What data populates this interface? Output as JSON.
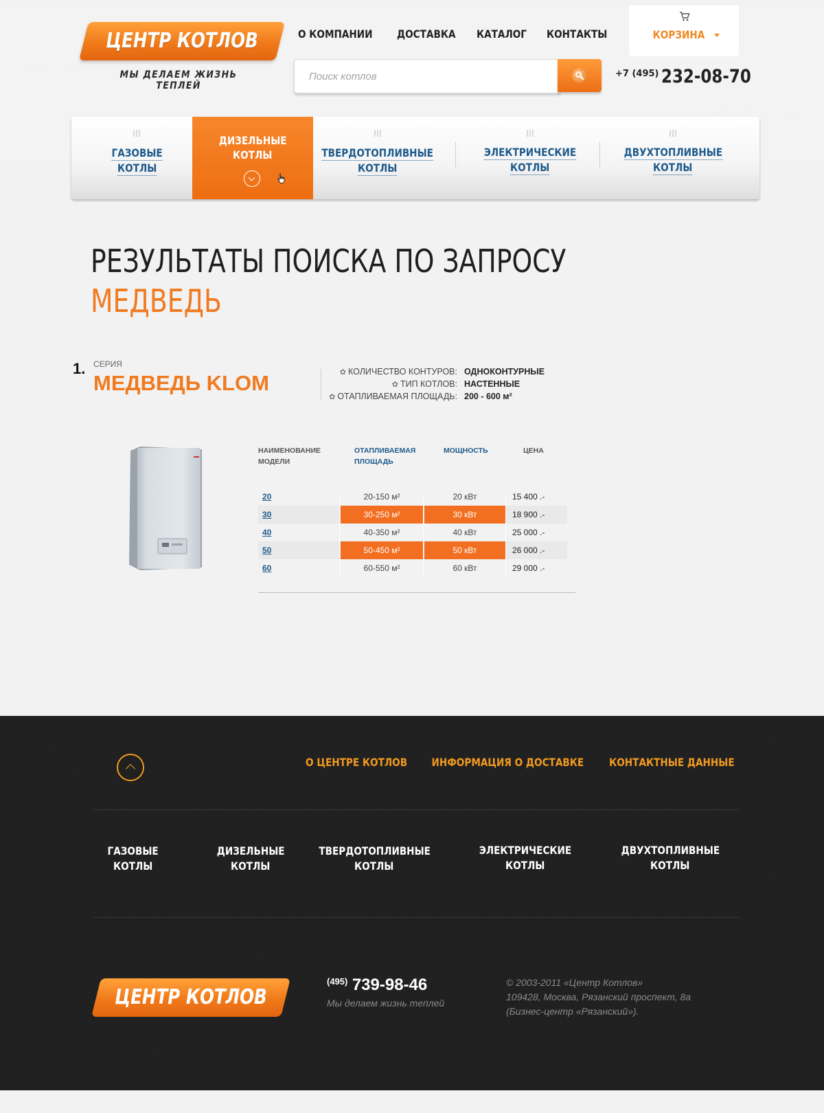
{
  "header": {
    "logo_text": "ЦЕНТР КОТЛОВ",
    "tagline": "МЫ ДЕЛАЕМ ЖИЗНЬ ТЕПЛЕЙ",
    "nav": [
      "О КОМПАНИИ",
      "ДОСТАВКА",
      "КАТАЛОГ",
      "КОНТАКТЫ"
    ],
    "cart_label": "КОРЗИНА",
    "search": {
      "placeholder": "Поиск котлов",
      "value": ""
    },
    "phone_code": "+7 (495)",
    "phone_number": "232-08-70"
  },
  "categories": [
    {
      "line1": "ГАЗОВЫЕ",
      "line2": "КОТЛЫ",
      "active": false
    },
    {
      "line1": "ДИЗЕЛЬНЫЕ",
      "line2": "КОТЛЫ",
      "active": true
    },
    {
      "line1": "ТВЕРДОТОПЛИВНЫЕ",
      "line2": "КОТЛЫ",
      "active": false
    },
    {
      "line1": "ЭЛЕКТРИЧЕСКИЕ",
      "line2": "КОТЛЫ",
      "active": false
    },
    {
      "line1": "ДВУХТОПЛИВНЫЕ",
      "line2": "КОТЛЫ",
      "active": false
    }
  ],
  "results": {
    "title": "РЕЗУЛЬТАТЫ ПОИСКА ПО ЗАПРОСУ",
    "query": "МЕДВЕДЬ",
    "item_number": "1.",
    "series_label": "СЕРИЯ",
    "series_name": "МЕДВЕДЬ KLOM",
    "specs": [
      {
        "key": "КОЛИЧЕСТВО КОНТУРОВ:",
        "value": "ОДНОКОНТУРНЫЕ"
      },
      {
        "key": "ТИП КОТЛОВ:",
        "value": "НАСТЕННЫЕ"
      },
      {
        "key": "ОТАПЛИВАЕМАЯ ПЛОЩАДЬ:",
        "value": "200 - 600 м²"
      }
    ],
    "table": {
      "headers": {
        "model": "НАИМЕНОВАНИЕ МОДЕЛИ",
        "area": "ОТАПЛИВАЕМАЯ ПЛОЩАДЬ",
        "power": "МОЩНОСТЬ",
        "price": "ЦЕНА"
      },
      "rows": [
        {
          "model": "20",
          "area": "20-150 м²",
          "power": "20 кВт",
          "price": "15 400 .-",
          "highlight": false
        },
        {
          "model": "30",
          "area": "30-250 м²",
          "power": "30 кВт",
          "price": "18 900 .-",
          "highlight": true
        },
        {
          "model": "40",
          "area": "40-350 м²",
          "power": "40 кВт",
          "price": "25 000 .-",
          "highlight": false
        },
        {
          "model": "50",
          "area": "50-450 м²",
          "power": "50 кВт",
          "price": "26 000 .-",
          "highlight": true
        },
        {
          "model": "60",
          "area": "60-550 м²",
          "power": "60 кВт",
          "price": "29 000 .-",
          "highlight": false
        }
      ]
    }
  },
  "footer": {
    "links": [
      "О ЦЕНТРЕ КОТЛОВ",
      "ИНФОРМАЦИЯ О ДОСТАВКЕ",
      "КОНТАКТНЫЕ ДАННЫЕ"
    ],
    "categories": [
      {
        "line1": "ГАЗОВЫЕ",
        "line2": "КОТЛЫ"
      },
      {
        "line1": "ДИЗЕЛЬНЫЕ",
        "line2": "КОТЛЫ"
      },
      {
        "line1": "ТВЕРДОТОПЛИВНЫЕ",
        "line2": "КОТЛЫ"
      },
      {
        "line1": "ЭЛЕКТРИЧЕСКИЕ",
        "line2": "КОТЛЫ"
      },
      {
        "line1": "ДВУХТОПЛИВНЫЕ",
        "line2": "КОТЛЫ"
      }
    ],
    "logo_text": "ЦЕНТР КОТЛОВ",
    "phone_code": "(495)",
    "phone_number": "739-98-46",
    "slogan": "Мы делаем жизнь теплей",
    "copyright": "© 2003-2011 «Центр Котлов»",
    "address": "109428, Москва, Рязанский проспект, 8а",
    "building": "(Бизнес-центр «Рязанский»)."
  },
  "colors": {
    "accent": "#f07a20",
    "link": "#1e5b8c",
    "footer_bg": "#1f1f1f",
    "footer_accent": "#f29a1f"
  },
  "icons": [
    "cart-icon",
    "search-icon",
    "steam-icon",
    "chevron-down-icon",
    "gear-icon",
    "arrow-up-icon",
    "cursor-hand-icon"
  ]
}
